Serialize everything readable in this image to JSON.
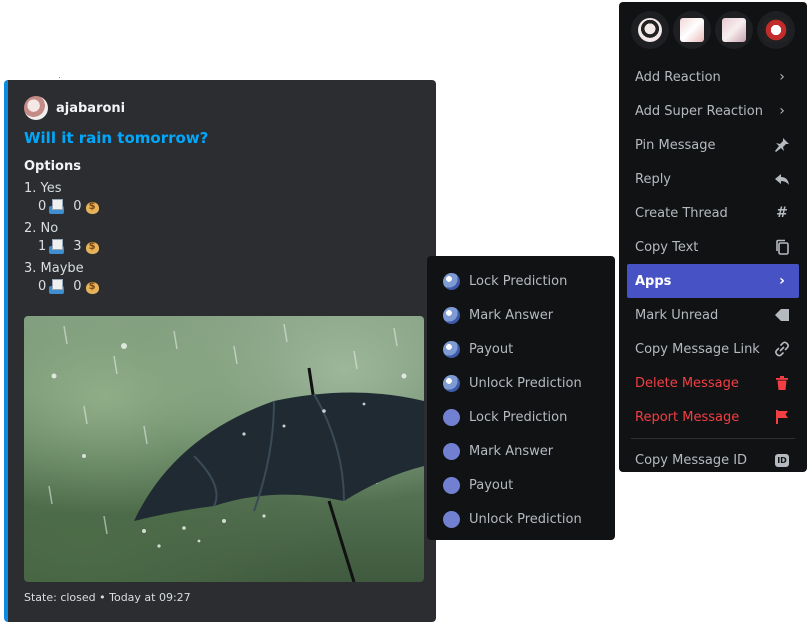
{
  "message": {
    "author": "ajabaroni",
    "title": "Will it rain tomorrow?",
    "field_name": "Options",
    "options": [
      {
        "label": "1. Yes",
        "votes": "0",
        "amount": "0"
      },
      {
        "label": "2. No",
        "votes": "1",
        "amount": "3"
      },
      {
        "label": "3. Maybe",
        "votes": "0",
        "amount": "0"
      }
    ],
    "footer": "State: closed • Today at 09:27",
    "accent_color": "#0b8be3",
    "image_icon": "umbrella-in-rain-photo"
  },
  "apps_menu": {
    "items": [
      {
        "label": "Lock Prediction",
        "icon": "bot-avatar-icon"
      },
      {
        "label": "Mark Answer",
        "icon": "bot-avatar-icon"
      },
      {
        "label": "Payout",
        "icon": "bot-avatar-icon"
      },
      {
        "label": "Unlock Prediction",
        "icon": "bot-avatar-icon"
      },
      {
        "label": "Lock Prediction",
        "icon": "blank-avatar-icon"
      },
      {
        "label": "Mark Answer",
        "icon": "blank-avatar-icon"
      },
      {
        "label": "Payout",
        "icon": "blank-avatar-icon"
      },
      {
        "label": "Unlock Prediction",
        "icon": "blank-avatar-icon"
      }
    ]
  },
  "context_menu": {
    "quick_reactions": [
      "custom-emoji-1",
      "custom-emoji-2",
      "custom-emoji-3",
      "custom-emoji-4"
    ],
    "items": [
      {
        "label": "Add Reaction",
        "icon": "chevron-right-icon"
      },
      {
        "label": "Add Super Reaction",
        "icon": "chevron-right-icon"
      },
      {
        "label": "Pin Message",
        "icon": "pin-icon"
      },
      {
        "label": "Reply",
        "icon": "reply-icon"
      },
      {
        "label": "Create Thread",
        "icon": "thread-icon"
      },
      {
        "label": "Copy Text",
        "icon": "copy-icon"
      },
      {
        "label": "Apps",
        "icon": "chevron-right-icon",
        "active": true
      },
      {
        "label": "Mark Unread",
        "icon": "mark-unread-icon"
      },
      {
        "label": "Copy Message Link",
        "icon": "link-icon"
      },
      {
        "label": "Delete Message",
        "icon": "trash-icon",
        "danger": true
      },
      {
        "label": "Report Message",
        "icon": "flag-icon",
        "danger": true
      },
      {
        "label": "Copy Message ID",
        "icon": "id-icon",
        "badge": "ID"
      }
    ],
    "active_color": "#4752c4",
    "danger_color": "#f23f43"
  }
}
